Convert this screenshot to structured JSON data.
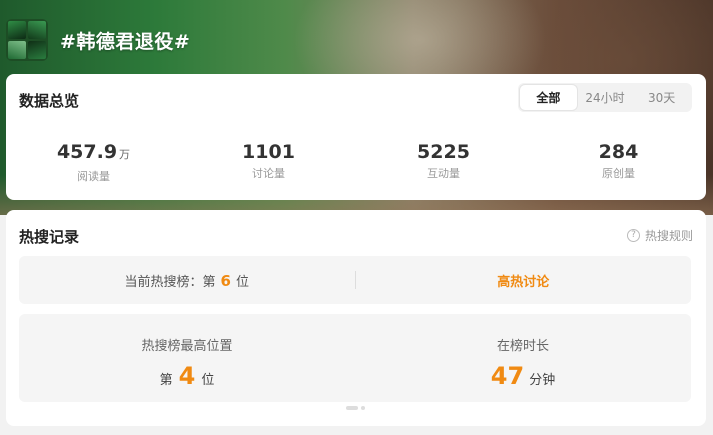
{
  "topic": {
    "title": "#韩德君退役#",
    "avatar_icon": "team-photo-avatar"
  },
  "overview": {
    "title": "数据总览",
    "tabs": [
      {
        "label": "全部",
        "active": true
      },
      {
        "label": "24小时",
        "active": false
      },
      {
        "label": "30天",
        "active": false
      }
    ],
    "stats": [
      {
        "value": "457.9",
        "unit": "万",
        "label": "阅读量"
      },
      {
        "value": "1101",
        "unit": "",
        "label": "讨论量"
      },
      {
        "value": "5225",
        "unit": "",
        "label": "互动量"
      },
      {
        "value": "284",
        "unit": "",
        "label": "原创量"
      }
    ]
  },
  "record": {
    "title": "热搜记录",
    "rules_label": "热搜规则",
    "rules_icon": "question-circle-icon",
    "current": {
      "prefix": "当前热搜榜：第",
      "rank": "6",
      "suffix": "位",
      "tag": "高热讨论"
    },
    "peak": {
      "label": "热搜榜最高位置",
      "prefix": "第",
      "rank": "4",
      "suffix": "位"
    },
    "duration": {
      "label": "在榜时长",
      "value": "47",
      "unit": "分钟"
    }
  },
  "colors": {
    "accent": "#f08a12",
    "text": "#333333",
    "muted": "#999999"
  }
}
